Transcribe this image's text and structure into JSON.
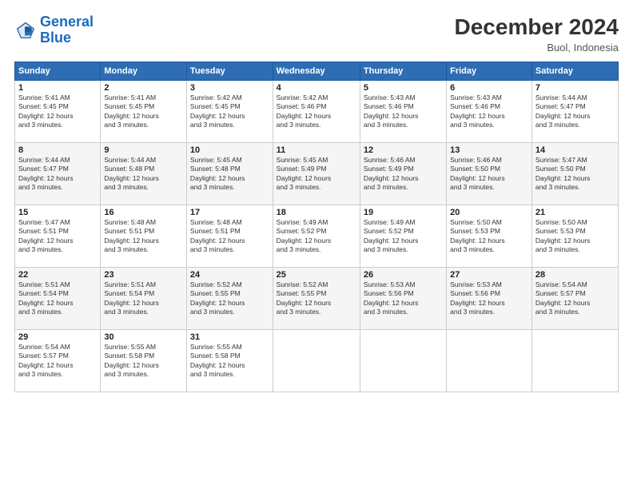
{
  "logo": {
    "line1": "General",
    "line2": "Blue"
  },
  "title": "December 2024",
  "subtitle": "Buol, Indonesia",
  "days_header": [
    "Sunday",
    "Monday",
    "Tuesday",
    "Wednesday",
    "Thursday",
    "Friday",
    "Saturday"
  ],
  "weeks": [
    [
      {
        "day": "1",
        "info": "Sunrise: 5:41 AM\nSunset: 5:45 PM\nDaylight: 12 hours\nand 3 minutes."
      },
      {
        "day": "2",
        "info": "Sunrise: 5:41 AM\nSunset: 5:45 PM\nDaylight: 12 hours\nand 3 minutes."
      },
      {
        "day": "3",
        "info": "Sunrise: 5:42 AM\nSunset: 5:45 PM\nDaylight: 12 hours\nand 3 minutes."
      },
      {
        "day": "4",
        "info": "Sunrise: 5:42 AM\nSunset: 5:46 PM\nDaylight: 12 hours\nand 3 minutes."
      },
      {
        "day": "5",
        "info": "Sunrise: 5:43 AM\nSunset: 5:46 PM\nDaylight: 12 hours\nand 3 minutes."
      },
      {
        "day": "6",
        "info": "Sunrise: 5:43 AM\nSunset: 5:46 PM\nDaylight: 12 hours\nand 3 minutes."
      },
      {
        "day": "7",
        "info": "Sunrise: 5:44 AM\nSunset: 5:47 PM\nDaylight: 12 hours\nand 3 minutes."
      }
    ],
    [
      {
        "day": "8",
        "info": "Sunrise: 5:44 AM\nSunset: 5:47 PM\nDaylight: 12 hours\nand 3 minutes."
      },
      {
        "day": "9",
        "info": "Sunrise: 5:44 AM\nSunset: 5:48 PM\nDaylight: 12 hours\nand 3 minutes."
      },
      {
        "day": "10",
        "info": "Sunrise: 5:45 AM\nSunset: 5:48 PM\nDaylight: 12 hours\nand 3 minutes."
      },
      {
        "day": "11",
        "info": "Sunrise: 5:45 AM\nSunset: 5:49 PM\nDaylight: 12 hours\nand 3 minutes."
      },
      {
        "day": "12",
        "info": "Sunrise: 5:46 AM\nSunset: 5:49 PM\nDaylight: 12 hours\nand 3 minutes."
      },
      {
        "day": "13",
        "info": "Sunrise: 5:46 AM\nSunset: 5:50 PM\nDaylight: 12 hours\nand 3 minutes."
      },
      {
        "day": "14",
        "info": "Sunrise: 5:47 AM\nSunset: 5:50 PM\nDaylight: 12 hours\nand 3 minutes."
      }
    ],
    [
      {
        "day": "15",
        "info": "Sunrise: 5:47 AM\nSunset: 5:51 PM\nDaylight: 12 hours\nand 3 minutes."
      },
      {
        "day": "16",
        "info": "Sunrise: 5:48 AM\nSunset: 5:51 PM\nDaylight: 12 hours\nand 3 minutes."
      },
      {
        "day": "17",
        "info": "Sunrise: 5:48 AM\nSunset: 5:51 PM\nDaylight: 12 hours\nand 3 minutes."
      },
      {
        "day": "18",
        "info": "Sunrise: 5:49 AM\nSunset: 5:52 PM\nDaylight: 12 hours\nand 3 minutes."
      },
      {
        "day": "19",
        "info": "Sunrise: 5:49 AM\nSunset: 5:52 PM\nDaylight: 12 hours\nand 3 minutes."
      },
      {
        "day": "20",
        "info": "Sunrise: 5:50 AM\nSunset: 5:53 PM\nDaylight: 12 hours\nand 3 minutes."
      },
      {
        "day": "21",
        "info": "Sunrise: 5:50 AM\nSunset: 5:53 PM\nDaylight: 12 hours\nand 3 minutes."
      }
    ],
    [
      {
        "day": "22",
        "info": "Sunrise: 5:51 AM\nSunset: 5:54 PM\nDaylight: 12 hours\nand 3 minutes."
      },
      {
        "day": "23",
        "info": "Sunrise: 5:51 AM\nSunset: 5:54 PM\nDaylight: 12 hours\nand 3 minutes."
      },
      {
        "day": "24",
        "info": "Sunrise: 5:52 AM\nSunset: 5:55 PM\nDaylight: 12 hours\nand 3 minutes."
      },
      {
        "day": "25",
        "info": "Sunrise: 5:52 AM\nSunset: 5:55 PM\nDaylight: 12 hours\nand 3 minutes."
      },
      {
        "day": "26",
        "info": "Sunrise: 5:53 AM\nSunset: 5:56 PM\nDaylight: 12 hours\nand 3 minutes."
      },
      {
        "day": "27",
        "info": "Sunrise: 5:53 AM\nSunset: 5:56 PM\nDaylight: 12 hours\nand 3 minutes."
      },
      {
        "day": "28",
        "info": "Sunrise: 5:54 AM\nSunset: 5:57 PM\nDaylight: 12 hours\nand 3 minutes."
      }
    ],
    [
      {
        "day": "29",
        "info": "Sunrise: 5:54 AM\nSunset: 5:57 PM\nDaylight: 12 hours\nand 3 minutes."
      },
      {
        "day": "30",
        "info": "Sunrise: 5:55 AM\nSunset: 5:58 PM\nDaylight: 12 hours\nand 3 minutes."
      },
      {
        "day": "31",
        "info": "Sunrise: 5:55 AM\nSunset: 5:58 PM\nDaylight: 12 hours\nand 3 minutes."
      },
      null,
      null,
      null,
      null
    ]
  ]
}
